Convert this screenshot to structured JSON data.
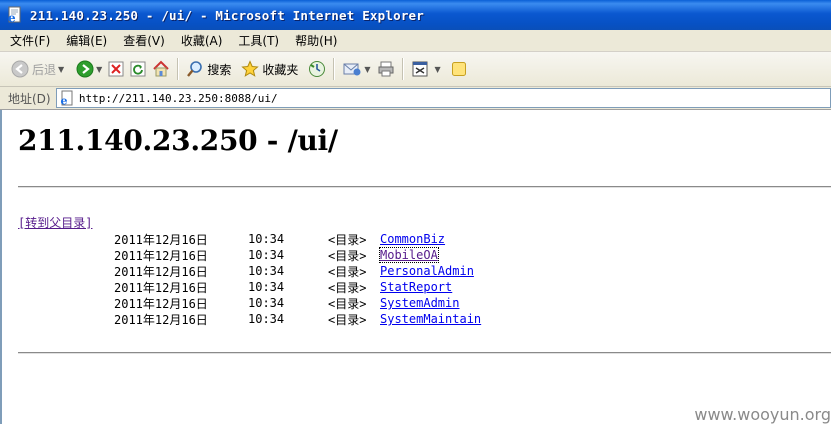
{
  "window": {
    "title": "211.140.23.250 - /ui/ - Microsoft Internet Explorer",
    "title_bar_color": "#0a58d0"
  },
  "menubar": {
    "items": [
      {
        "label": "文件(F)"
      },
      {
        "label": "编辑(E)"
      },
      {
        "label": "查看(V)"
      },
      {
        "label": "收藏(A)"
      },
      {
        "label": "工具(T)"
      },
      {
        "label": "帮助(H)"
      }
    ]
  },
  "toolbar": {
    "back_label": "后退",
    "search_label": "搜索",
    "favorites_label": "收藏夹",
    "icons": [
      "back-icon",
      "forward-icon",
      "stop-icon",
      "refresh-icon",
      "home-icon",
      "search-icon",
      "favorites-icon",
      "history-icon",
      "mail-icon",
      "print-icon",
      "edit-icon",
      "messenger-icon"
    ]
  },
  "address": {
    "label": "地址(D)",
    "url": "http://211.140.23.250:8088/ui/"
  },
  "page": {
    "heading": "211.140.23.250 - /ui/",
    "parent_link": "[转到父目录]",
    "entries": [
      {
        "date": "2011年12月16日",
        "time": "10:34",
        "type": "<目录>",
        "name": "CommonBiz"
      },
      {
        "date": "2011年12月16日",
        "time": "10:34",
        "type": "<目录>",
        "name": "MobileOA"
      },
      {
        "date": "2011年12月16日",
        "time": "10:34",
        "type": "<目录>",
        "name": "PersonalAdmin"
      },
      {
        "date": "2011年12月16日",
        "time": "10:34",
        "type": "<目录>",
        "name": "StatReport"
      },
      {
        "date": "2011年12月16日",
        "time": "10:34",
        "type": "<目录>",
        "name": "SystemAdmin"
      },
      {
        "date": "2011年12月16日",
        "time": "10:34",
        "type": "<目录>",
        "name": "SystemMaintain"
      }
    ],
    "link_color": "#0000ee",
    "visited_color": "#551a8b"
  },
  "watermark": "www.wooyun.org"
}
